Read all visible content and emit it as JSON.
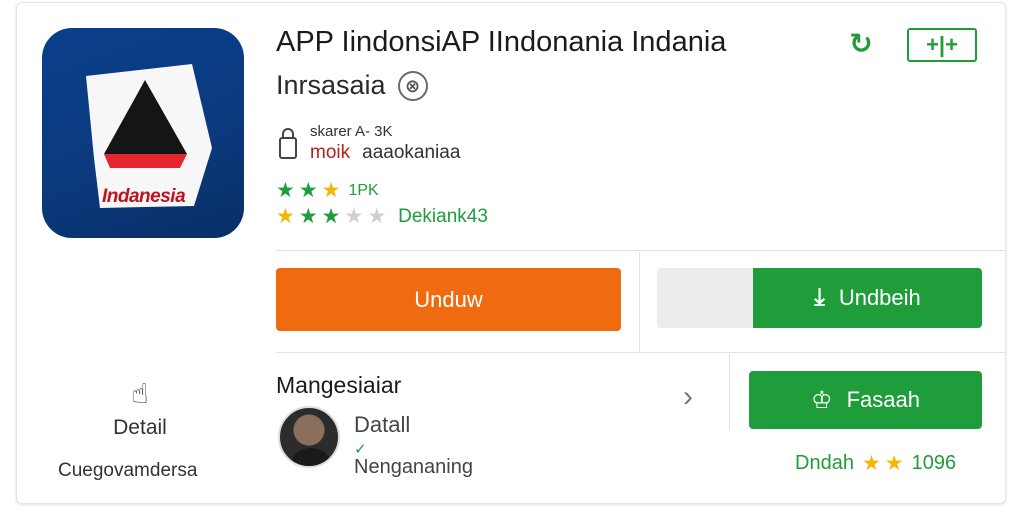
{
  "app": {
    "title": "APP IindonsiAP IIndonania Indania",
    "subtitle": "Inrsasaia",
    "close_glyph": "⊗",
    "icon_text": "Indanesia",
    "icon_name": "app-logo-icon"
  },
  "toolbar": {
    "refresh_glyph": "↻",
    "add_label": "+|+"
  },
  "developer": {
    "line1": "skarer A- 3K",
    "line2_accent": "moik",
    "line2_text": "aaaokaniaa"
  },
  "ratings": {
    "row1": {
      "stars_filled": 3,
      "count": "1PK"
    },
    "row2": {
      "stars_filled": 3,
      "stars_total": 5,
      "label": "Dekiank43"
    }
  },
  "actions": {
    "primary_label": "Unduw",
    "install_label": "Undbeih",
    "install_icon": "download-icon"
  },
  "details": {
    "label": "Detail",
    "sub_label": "Cuegovamdersa",
    "icon": "hand-icon"
  },
  "publisher": {
    "section_title": "Mangesiaiar",
    "name": "Datall",
    "check_glyph": "✓",
    "meta": "Nengananing",
    "chevron_glyph": "›"
  },
  "follow": {
    "label": "Fasaah",
    "icon": "crown-icon"
  },
  "bottom_rating": {
    "label": "Dndah",
    "stars_filled": 2,
    "value": "1096"
  },
  "colors": {
    "brand_green": "#1f9d3a",
    "brand_orange": "#f06a0f",
    "icon_blue": "#0a3f8c",
    "star_yellow": "#f2b705"
  }
}
